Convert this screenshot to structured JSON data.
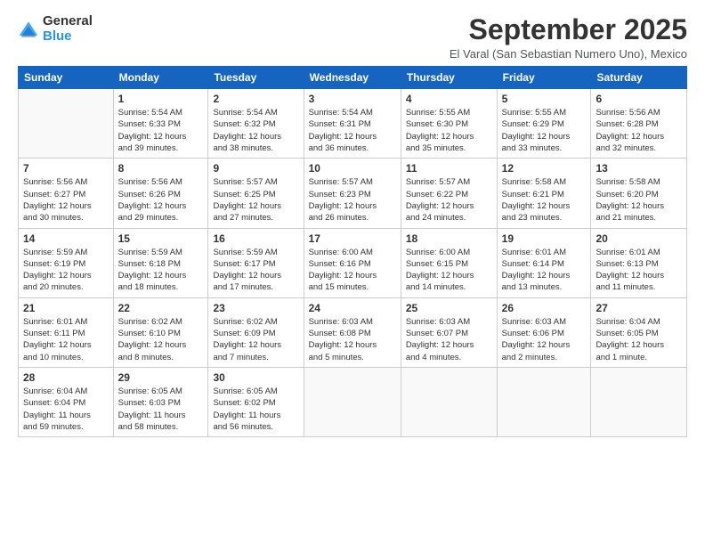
{
  "logo": {
    "text_general": "General",
    "text_blue": "Blue"
  },
  "header": {
    "month": "September 2025",
    "subtitle": "El Varal (San Sebastian Numero Uno), Mexico"
  },
  "days_of_week": [
    "Sunday",
    "Monday",
    "Tuesday",
    "Wednesday",
    "Thursday",
    "Friday",
    "Saturday"
  ],
  "weeks": [
    [
      {
        "day": "",
        "info": ""
      },
      {
        "day": "1",
        "info": "Sunrise: 5:54 AM\nSunset: 6:33 PM\nDaylight: 12 hours\nand 39 minutes."
      },
      {
        "day": "2",
        "info": "Sunrise: 5:54 AM\nSunset: 6:32 PM\nDaylight: 12 hours\nand 38 minutes."
      },
      {
        "day": "3",
        "info": "Sunrise: 5:54 AM\nSunset: 6:31 PM\nDaylight: 12 hours\nand 36 minutes."
      },
      {
        "day": "4",
        "info": "Sunrise: 5:55 AM\nSunset: 6:30 PM\nDaylight: 12 hours\nand 35 minutes."
      },
      {
        "day": "5",
        "info": "Sunrise: 5:55 AM\nSunset: 6:29 PM\nDaylight: 12 hours\nand 33 minutes."
      },
      {
        "day": "6",
        "info": "Sunrise: 5:56 AM\nSunset: 6:28 PM\nDaylight: 12 hours\nand 32 minutes."
      }
    ],
    [
      {
        "day": "7",
        "info": "Sunrise: 5:56 AM\nSunset: 6:27 PM\nDaylight: 12 hours\nand 30 minutes."
      },
      {
        "day": "8",
        "info": "Sunrise: 5:56 AM\nSunset: 6:26 PM\nDaylight: 12 hours\nand 29 minutes."
      },
      {
        "day": "9",
        "info": "Sunrise: 5:57 AM\nSunset: 6:25 PM\nDaylight: 12 hours\nand 27 minutes."
      },
      {
        "day": "10",
        "info": "Sunrise: 5:57 AM\nSunset: 6:23 PM\nDaylight: 12 hours\nand 26 minutes."
      },
      {
        "day": "11",
        "info": "Sunrise: 5:57 AM\nSunset: 6:22 PM\nDaylight: 12 hours\nand 24 minutes."
      },
      {
        "day": "12",
        "info": "Sunrise: 5:58 AM\nSunset: 6:21 PM\nDaylight: 12 hours\nand 23 minutes."
      },
      {
        "day": "13",
        "info": "Sunrise: 5:58 AM\nSunset: 6:20 PM\nDaylight: 12 hours\nand 21 minutes."
      }
    ],
    [
      {
        "day": "14",
        "info": "Sunrise: 5:59 AM\nSunset: 6:19 PM\nDaylight: 12 hours\nand 20 minutes."
      },
      {
        "day": "15",
        "info": "Sunrise: 5:59 AM\nSunset: 6:18 PM\nDaylight: 12 hours\nand 18 minutes."
      },
      {
        "day": "16",
        "info": "Sunrise: 5:59 AM\nSunset: 6:17 PM\nDaylight: 12 hours\nand 17 minutes."
      },
      {
        "day": "17",
        "info": "Sunrise: 6:00 AM\nSunset: 6:16 PM\nDaylight: 12 hours\nand 15 minutes."
      },
      {
        "day": "18",
        "info": "Sunrise: 6:00 AM\nSunset: 6:15 PM\nDaylight: 12 hours\nand 14 minutes."
      },
      {
        "day": "19",
        "info": "Sunrise: 6:01 AM\nSunset: 6:14 PM\nDaylight: 12 hours\nand 13 minutes."
      },
      {
        "day": "20",
        "info": "Sunrise: 6:01 AM\nSunset: 6:13 PM\nDaylight: 12 hours\nand 11 minutes."
      }
    ],
    [
      {
        "day": "21",
        "info": "Sunrise: 6:01 AM\nSunset: 6:11 PM\nDaylight: 12 hours\nand 10 minutes."
      },
      {
        "day": "22",
        "info": "Sunrise: 6:02 AM\nSunset: 6:10 PM\nDaylight: 12 hours\nand 8 minutes."
      },
      {
        "day": "23",
        "info": "Sunrise: 6:02 AM\nSunset: 6:09 PM\nDaylight: 12 hours\nand 7 minutes."
      },
      {
        "day": "24",
        "info": "Sunrise: 6:03 AM\nSunset: 6:08 PM\nDaylight: 12 hours\nand 5 minutes."
      },
      {
        "day": "25",
        "info": "Sunrise: 6:03 AM\nSunset: 6:07 PM\nDaylight: 12 hours\nand 4 minutes."
      },
      {
        "day": "26",
        "info": "Sunrise: 6:03 AM\nSunset: 6:06 PM\nDaylight: 12 hours\nand 2 minutes."
      },
      {
        "day": "27",
        "info": "Sunrise: 6:04 AM\nSunset: 6:05 PM\nDaylight: 12 hours\nand 1 minute."
      }
    ],
    [
      {
        "day": "28",
        "info": "Sunrise: 6:04 AM\nSunset: 6:04 PM\nDaylight: 11 hours\nand 59 minutes."
      },
      {
        "day": "29",
        "info": "Sunrise: 6:05 AM\nSunset: 6:03 PM\nDaylight: 11 hours\nand 58 minutes."
      },
      {
        "day": "30",
        "info": "Sunrise: 6:05 AM\nSunset: 6:02 PM\nDaylight: 11 hours\nand 56 minutes."
      },
      {
        "day": "",
        "info": ""
      },
      {
        "day": "",
        "info": ""
      },
      {
        "day": "",
        "info": ""
      },
      {
        "day": "",
        "info": ""
      }
    ]
  ]
}
